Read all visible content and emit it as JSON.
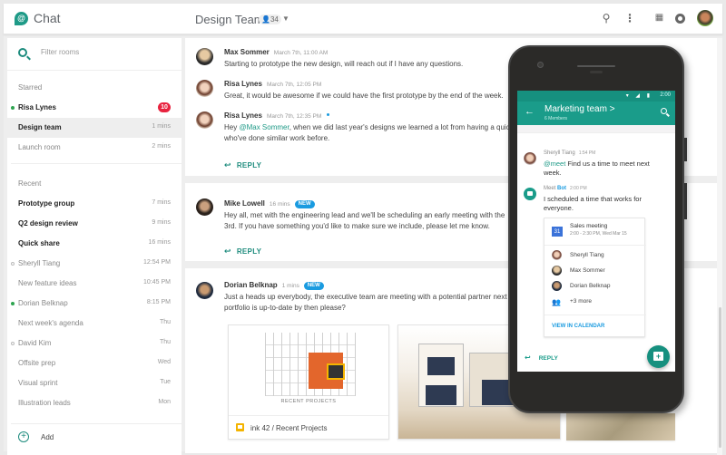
{
  "header": {
    "app_name": "Chat",
    "room_title": "Design Team",
    "member_count": "34",
    "icons": [
      "search-icon",
      "more-vert-icon",
      "apps-grid-icon",
      "notifications-icon",
      "account-avatar"
    ]
  },
  "sidebar": {
    "filter_placeholder": "Filter rooms",
    "starred_label": "Starred",
    "recent_label": "Recent",
    "add_label": "Add",
    "starred": [
      {
        "name": "Risa Lynes",
        "time": "",
        "badge": "10",
        "bold": true,
        "presence": "online",
        "active": false
      },
      {
        "name": "Design team",
        "time": "1 mins",
        "bold": true,
        "presence": "",
        "active": true
      },
      {
        "name": "Launch room",
        "time": "2 mins",
        "bold": false,
        "presence": "",
        "active": false
      }
    ],
    "recent": [
      {
        "name": "Prototype group",
        "time": "7 mins",
        "bold": true,
        "presence": ""
      },
      {
        "name": "Q2 design review",
        "time": "9 mins",
        "bold": true,
        "presence": ""
      },
      {
        "name": "Quick share",
        "time": "16 mins",
        "bold": true,
        "presence": ""
      },
      {
        "name": "Sheryll Tiang",
        "time": "12:54 PM",
        "bold": false,
        "presence": "away"
      },
      {
        "name": "New feature ideas",
        "time": "10:45 PM",
        "bold": false,
        "presence": ""
      },
      {
        "name": "Dorian Belknap",
        "time": "8:15 PM",
        "bold": false,
        "presence": "online"
      },
      {
        "name": "Next week's agenda",
        "time": "Thu",
        "bold": false,
        "presence": ""
      },
      {
        "name": "David Kim",
        "time": "Thu",
        "bold": false,
        "presence": "away"
      },
      {
        "name": "Offsite prep",
        "time": "Wed",
        "bold": false,
        "presence": ""
      },
      {
        "name": "Visual sprint",
        "time": "Tue",
        "bold": false,
        "presence": ""
      },
      {
        "name": "Illustration leads",
        "time": "Mon",
        "bold": false,
        "presence": ""
      }
    ]
  },
  "threads": [
    {
      "messages": [
        {
          "author": "Max Sommer",
          "time": "March 7th, 11:00 AM",
          "text": "Starting to prototype the new design, will reach out if I have any questions."
        },
        {
          "author": "Risa Lynes",
          "time": "March 7th, 12:05 PM",
          "text": "Great, it would be awesome if we could have the first prototype by the end of the week."
        },
        {
          "author": "Risa Lynes",
          "time": "March 7th, 12:35 PM",
          "mention": "@Max Sommer",
          "text_before": "Hey ",
          "text_after": ", when we did last year's designs we learned a lot from having a quic",
          "text_line2": "who've done similar work before."
        }
      ],
      "reply_label": "REPLY"
    },
    {
      "messages": [
        {
          "author": "Mike Lowell",
          "time": "16 mins",
          "badge": "NEW",
          "text": "Hey all, met with the engineering lead and we'll be scheduling an early meeting with the",
          "text_line2": "3rd. If you have something you'd like to make sure we include, please let me know."
        }
      ],
      "reply_label": "REPLY"
    },
    {
      "messages": [
        {
          "author": "Dorian Belknap",
          "time": "1 mins",
          "badge": "NEW",
          "text": "Just a heads up everybody, the executive team are meeting with a potential partner next",
          "text_line2": "portfolio is up-to-date by then please?"
        }
      ],
      "attachments": [
        {
          "name": "ink 42 / Recent Projects",
          "caption": "RECENT PROJECTS",
          "type": "slides"
        },
        {
          "name": "",
          "type": "image"
        }
      ]
    }
  ],
  "phone": {
    "status_time": "2:00",
    "status_icons": "▾ ◢ ▮",
    "room_title": "Marketing team >",
    "room_subtitle": "6 Members",
    "messages": [
      {
        "author": "Sheryll Tiang",
        "time": "1:54 PM",
        "mention": "@meet",
        "text": " Find us a time to meet next week."
      },
      {
        "author_prefix": "Meet ",
        "author_bot": "Bot",
        "time": "2:00 PM",
        "text": "I scheduled a time that works for everyone."
      }
    ],
    "event": {
      "calendar_day": "31",
      "title": "Sales meeting",
      "time": "2:00 - 2:30 PM, Wed Mar 15",
      "attendees": [
        "Sheryll Tiang",
        "Max Sommer",
        "Dorian Belknap"
      ],
      "more": "+3 more",
      "view_label": "VIEW IN CALENDAR"
    },
    "reply_label": "REPLY"
  },
  "colors": {
    "accent": "#1a9c8a",
    "unread_badge": "#e8233f",
    "new_badge": "#1a9be0",
    "online": "#2ea44f"
  }
}
